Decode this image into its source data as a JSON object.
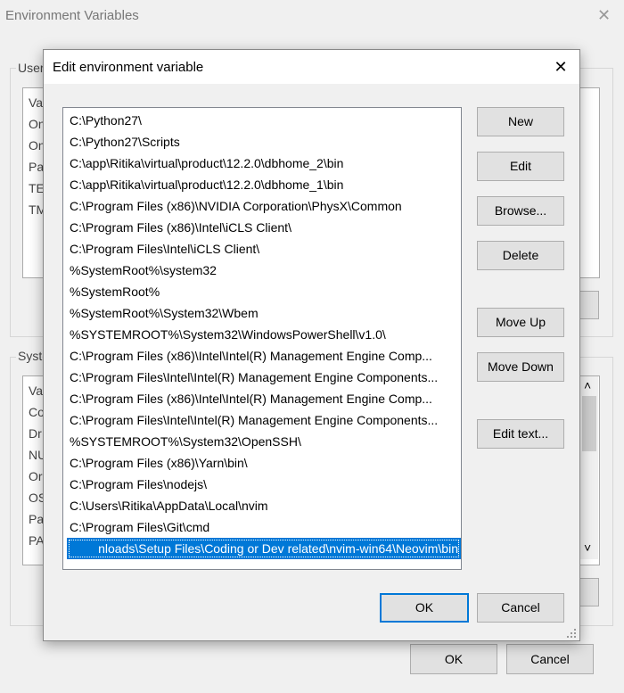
{
  "background_window": {
    "title": "Environment Variables",
    "user_group_label": "User",
    "user_vars_prefixes": [
      "Va",
      "On",
      "On",
      "Pa",
      "TE",
      "TM"
    ],
    "system_group_label": "Syste",
    "system_vars_prefixes": [
      "Va",
      "Co",
      "Dr",
      "NU",
      "Or",
      "OS",
      "Pa",
      "PA"
    ],
    "ok_label": "OK",
    "cancel_label": "Cancel",
    "scroll_up": "˄",
    "scroll_down": "˅"
  },
  "dialog": {
    "title": "Edit environment variable",
    "close_glyph": "✕",
    "paths": [
      "C:\\Python27\\",
      "C:\\Python27\\Scripts",
      "C:\\app\\Ritika\\virtual\\product\\12.2.0\\dbhome_2\\bin",
      "C:\\app\\Ritika\\virtual\\product\\12.2.0\\dbhome_1\\bin",
      "C:\\Program Files (x86)\\NVIDIA Corporation\\PhysX\\Common",
      "C:\\Program Files (x86)\\Intel\\iCLS Client\\",
      "C:\\Program Files\\Intel\\iCLS Client\\",
      "%SystemRoot%\\system32",
      "%SystemRoot%",
      "%SystemRoot%\\System32\\Wbem",
      "%SYSTEMROOT%\\System32\\WindowsPowerShell\\v1.0\\",
      "C:\\Program Files (x86)\\Intel\\Intel(R) Management Engine Comp...",
      "C:\\Program Files\\Intel\\Intel(R) Management Engine Components...",
      "C:\\Program Files (x86)\\Intel\\Intel(R) Management Engine Comp...",
      "C:\\Program Files\\Intel\\Intel(R) Management Engine Components...",
      "%SYSTEMROOT%\\System32\\OpenSSH\\",
      "C:\\Program Files (x86)\\Yarn\\bin\\",
      "C:\\Program Files\\nodejs\\",
      "C:\\Users\\Ritika\\AppData\\Local\\nvim",
      "C:\\Program Files\\Git\\cmd"
    ],
    "editing_value": "nloads\\Setup Files\\Coding or Dev related\\nvim-win64\\Neovim\\bin",
    "buttons": {
      "new": "New",
      "edit": "Edit",
      "browse": "Browse...",
      "delete": "Delete",
      "move_up": "Move Up",
      "move_down": "Move Down",
      "edit_text": "Edit text..."
    },
    "ok_label": "OK",
    "cancel_label": "Cancel"
  }
}
